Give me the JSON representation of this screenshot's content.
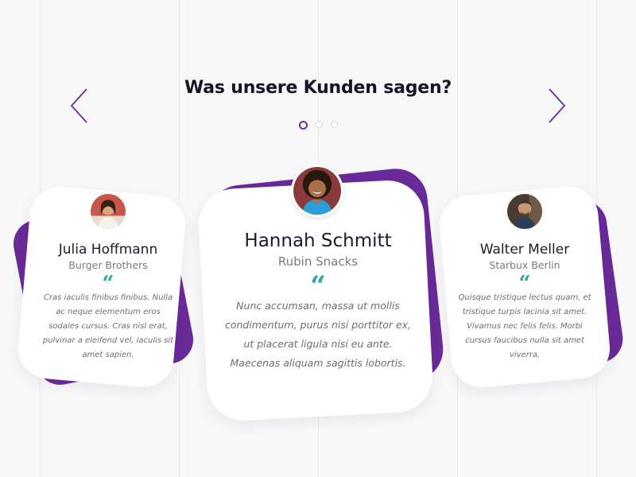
{
  "header": {
    "title": "Was unsere Kunden sagen?"
  },
  "carousel": {
    "prev_icon": "chevron-left-icon",
    "next_icon": "chevron-right-icon",
    "dots": [
      {
        "active": true
      },
      {
        "active": false
      },
      {
        "active": false
      }
    ]
  },
  "colors": {
    "accent": "#6a2a99",
    "quote": "#2aa89a",
    "title": "#151528"
  },
  "testimonials": [
    {
      "name": "Julia Hoffmann",
      "company": "Burger Brothers",
      "quote_mark": "“",
      "text": "Cras iaculis finibus finibus. Nulla ac neque elementum eros sodales cursus. Cras nisl erat, pulvinar a eleifend vel, iaculis sit amet sapien."
    },
    {
      "name": "Hannah Schmitt",
      "company": "Rubin Snacks",
      "quote_mark": "“",
      "text": "Nunc accumsan, massa ut mollis condimentum, purus nisi porttitor ex, ut placerat ligula nisi eu ante. Maecenas aliquam sagittis lobortis."
    },
    {
      "name": "Walter Meller",
      "company": "Starbux Berlin",
      "quote_mark": "“",
      "text": "Quisque tristique lectus quam, et tristique turpis lacinia sit amet. Vivamus nec felis felis. Morbi cursus faucibus nulla sit amet viverra."
    }
  ]
}
